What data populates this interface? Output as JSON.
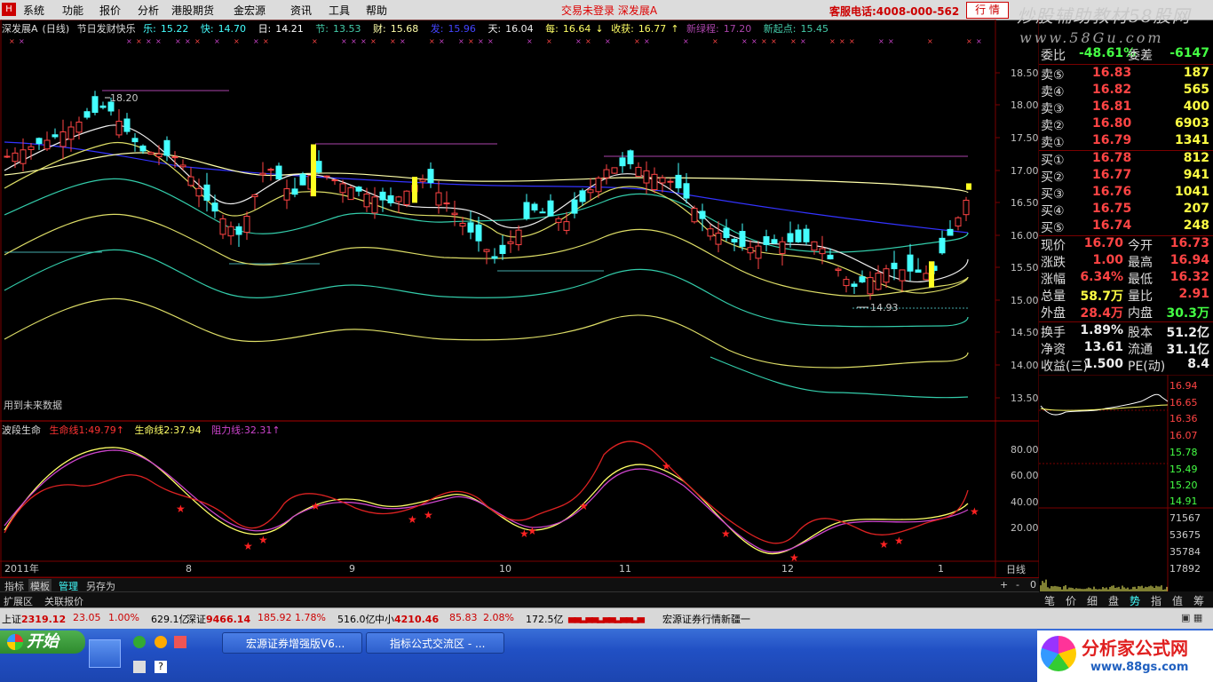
{
  "menu": {
    "logo": "H",
    "items": [
      "系统",
      "功能",
      "报价",
      "分析",
      "港股期货",
      "金宏源",
      "资讯",
      "工具",
      "帮助"
    ],
    "not_logged": "交易未登录 深发展A",
    "hotline": "客服电话:4008-000-562",
    "market_button": "行 情",
    "brand": "炒股辅助教材58股网",
    "brand_url": "www.58Gu.com"
  },
  "chart_header": {
    "name": "深发展A",
    "period": "(日线)",
    "indicator": "节日发财快乐",
    "items": [
      {
        "label": "乐:",
        "value": "15.22"
      },
      {
        "label": "快:",
        "value": "14.70"
      },
      {
        "label": "日:",
        "value": "14.21"
      },
      {
        "label": "节:",
        "value": "13.53"
      },
      {
        "label": "财:",
        "value": "15.68"
      },
      {
        "label": "发:",
        "value": "15.96"
      },
      {
        "label": "天:",
        "value": "16.04"
      },
      {
        "label": "每:",
        "value": "16.64"
      },
      {
        "label": "收获:",
        "value": "16.77"
      },
      {
        "label": "新绿程:",
        "value": "17.20"
      },
      {
        "label": "新起点:",
        "value": "15.45"
      }
    ],
    "future_note": "用到未来数据"
  },
  "main_axis": {
    "labels": [
      "18.50",
      "18.00",
      "17.50",
      "17.00",
      "16.50",
      "16.00",
      "15.50",
      "15.00",
      "14.50",
      "14.00",
      "13.50"
    ],
    "high_label": "18.20",
    "low_label": "14.93"
  },
  "sub_chart": {
    "title": "波段生命",
    "items": [
      {
        "label": "生命线1:",
        "value": "49.79"
      },
      {
        "label": "生命线2:",
        "value": "37.94"
      },
      {
        "label": "阻力线:",
        "value": "32.31"
      }
    ],
    "axis": [
      "80.00",
      "60.00",
      "40.00",
      "20.00"
    ]
  },
  "dates": {
    "labels": [
      "2011年",
      "8",
      "9",
      "10",
      "11",
      "12",
      "1"
    ],
    "cycle": "日线"
  },
  "quote": {
    "weibi": {
      "label": "委比",
      "value": "-48.61%",
      "label2": "委差",
      "value2": "-6147"
    },
    "sell": [
      {
        "k": "卖⑤",
        "p": "16.83",
        "v": "187"
      },
      {
        "k": "卖④",
        "p": "16.82",
        "v": "565"
      },
      {
        "k": "卖③",
        "p": "16.81",
        "v": "400"
      },
      {
        "k": "卖②",
        "p": "16.80",
        "v": "6903"
      },
      {
        "k": "卖①",
        "p": "16.79",
        "v": "1341"
      }
    ],
    "buy": [
      {
        "k": "买①",
        "p": "16.78",
        "v": "812"
      },
      {
        "k": "买②",
        "p": "16.77",
        "v": "941"
      },
      {
        "k": "买③",
        "p": "16.76",
        "v": "1041"
      },
      {
        "k": "买④",
        "p": "16.75",
        "v": "207"
      },
      {
        "k": "买⑤",
        "p": "16.74",
        "v": "248"
      }
    ],
    "stats": [
      {
        "k": "现价",
        "v1": "16.70",
        "k2": "今开",
        "v2": "16.73"
      },
      {
        "k": "涨跌",
        "v1": "1.00",
        "k2": "最高",
        "v2": "16.94"
      },
      {
        "k": "涨幅",
        "v1": "6.34%",
        "k2": "最低",
        "v2": "16.32"
      },
      {
        "k": "总量",
        "v1": "58.7万",
        "k2": "量比",
        "v2": "2.91"
      },
      {
        "k": "外盘",
        "v1": "28.4万",
        "k2": "内盘",
        "v2": "30.3万"
      },
      {
        "k": "换手",
        "v1": "1.89%",
        "k2": "股本",
        "v2": "51.2亿"
      },
      {
        "k": "净资",
        "v1": "13.61",
        "k2": "流通",
        "v2": "31.1亿"
      },
      {
        "k": "收益(三)",
        "v1": "1.500",
        "k2": "PE(动)",
        "v2": "8.4"
      }
    ]
  },
  "mini_chart": {
    "price_labels": [
      "16.94",
      "16.65",
      "16.36",
      "16.07",
      "15.78",
      "15.49",
      "15.20",
      "14.91"
    ],
    "vol_labels": [
      "71567",
      "53675",
      "35784",
      "17892"
    ]
  },
  "tabs1": [
    "指标",
    "模板",
    "管理",
    "另存为"
  ],
  "tabs1_right": [
    "+",
    "-",
    "0"
  ],
  "tabs2": [
    "扩展区",
    "关联报价"
  ],
  "rtabs": [
    "笔",
    "价",
    "细",
    "盘",
    "势",
    "指",
    "值",
    "筹"
  ],
  "status": {
    "sh_label": "上证",
    "sh_val": "2319.12",
    "sh_chg": "23.05",
    "sh_pct": "1.00%",
    "sh_amt": "629.1亿",
    "sz_label": "深证",
    "sz_val": "9466.14",
    "sz_chg": "185.92",
    "sz_pct": "1.78%",
    "sz_amt": "516.0亿",
    "zx_label": "中小",
    "zx_val": "4210.46",
    "zx_chg": "85.83",
    "zx_pct": "2.08%",
    "zx_amt": "172.5亿",
    "news": "宏源证券行情新疆一"
  },
  "taskbar": {
    "start": "开始",
    "tasks": [
      "宏源证券增强版V6...",
      "指标公式交流区 - ..."
    ],
    "watermark": "分析家公式网",
    "watermark_url": "www.88gs.com"
  },
  "colors": {
    "bg": "#000000",
    "grid": "#7a0000",
    "up": "#ff4444",
    "down": "#44ffff",
    "yellow": "#ffff44"
  }
}
